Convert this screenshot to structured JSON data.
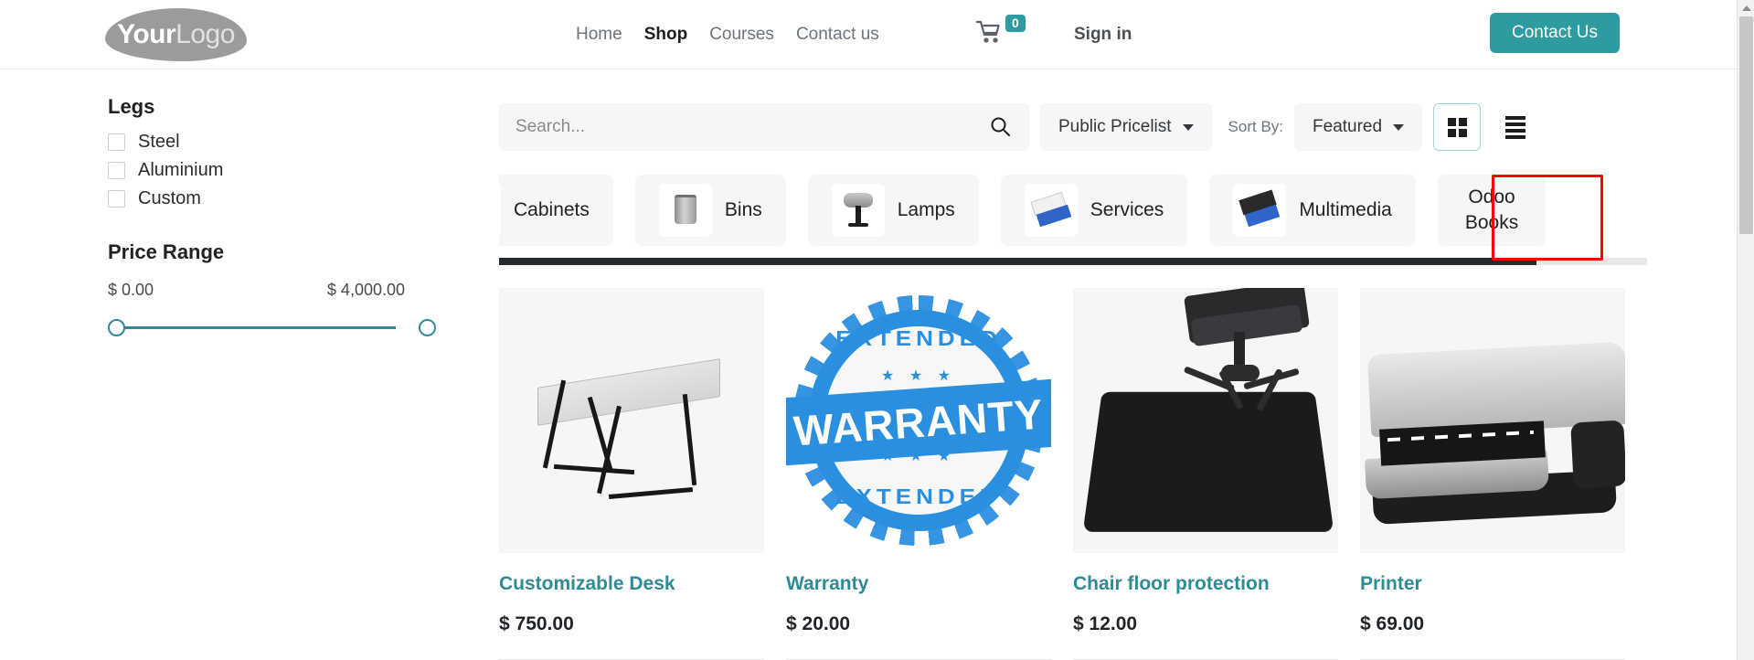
{
  "header": {
    "logo": {
      "primary": "Your",
      "secondary": "Logo"
    },
    "nav": [
      {
        "label": "Home",
        "active": false
      },
      {
        "label": "Shop",
        "active": true
      },
      {
        "label": "Courses",
        "active": false
      },
      {
        "label": "Contact us",
        "active": false
      }
    ],
    "cart": {
      "icon": "shopping-cart-icon",
      "count": "0",
      "badge_color": "#2e9ba1"
    },
    "sign_in": "Sign in",
    "contact_button": {
      "label": "Contact Us",
      "color": "#2e9ba1"
    }
  },
  "sidebar": {
    "legs": {
      "title": "Legs",
      "options": [
        {
          "label": "Steel",
          "checked": false
        },
        {
          "label": "Aluminium",
          "checked": false
        },
        {
          "label": "Custom",
          "checked": false
        }
      ]
    },
    "price_range": {
      "title": "Price Range",
      "min_label": "$ 0.00",
      "max_label": "$ 4,000.00",
      "min_value": 0,
      "max_value": 4000,
      "slider_color": "#2e8b96"
    }
  },
  "toolbar": {
    "search": {
      "placeholder": "Search...",
      "value": "",
      "icon": "search-icon"
    },
    "pricelist": {
      "label": "Public Pricelist",
      "icon": "chevron-down-icon"
    },
    "sort_by_label": "Sort By:",
    "sort_by": {
      "label": "Featured",
      "icon": "chevron-down-icon"
    },
    "grid_view": {
      "icon": "grid-view-icon",
      "active": true
    },
    "list_view": {
      "icon": "list-view-icon",
      "active": false
    }
  },
  "categories": {
    "tabs": [
      {
        "label": "Cabinets",
        "thumb": "cabinet-thumb-icon",
        "cut_off": true
      },
      {
        "label": "Bins",
        "thumb": "bin-thumb-icon"
      },
      {
        "label": "Lamps",
        "thumb": "lamp-thumb-icon"
      },
      {
        "label": "Services",
        "thumb": "services-thumb-icon"
      },
      {
        "label": "Multimedia",
        "thumb": "multimedia-thumb-icon"
      },
      {
        "label_line1": "Odoo",
        "label_line2": "Books",
        "thumb": null,
        "highlighted": true
      }
    ],
    "highlight_color": "#fd0000"
  },
  "products": [
    {
      "name": "Customizable Desk",
      "price": "$ 750.00",
      "image": "desk-image"
    },
    {
      "name": "Warranty",
      "price": "$ 20.00",
      "image": "warranty-stamp-image",
      "stamp": {
        "top_text": "EXTENDED",
        "band_text": "WARRANTY",
        "bottom_text": "EXTENDED",
        "stars": "★ ★ ★",
        "color": "#2b8fe0"
      }
    },
    {
      "name": "Chair floor protection",
      "price": "$ 12.00",
      "image": "chair-mat-image"
    },
    {
      "name": "Printer",
      "price": "$ 69.00",
      "image": "printer-image"
    }
  ],
  "theme": {
    "accent": "#2e9ba1",
    "link": "#2d8b94",
    "text": "#212529",
    "muted": "#6c757d"
  }
}
